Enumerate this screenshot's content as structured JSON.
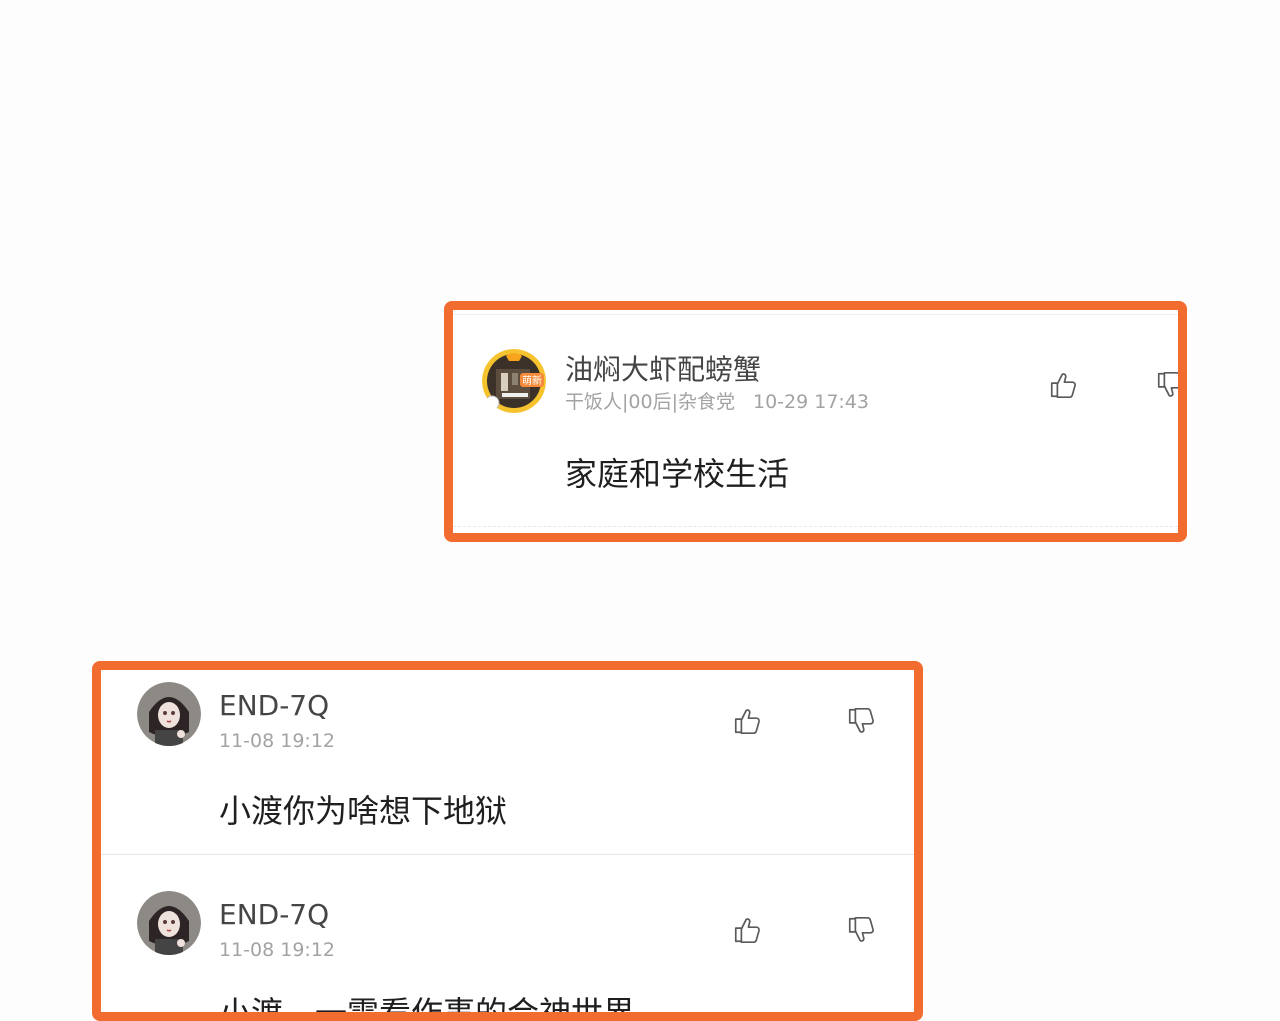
{
  "comments": [
    {
      "username": "油焖大虾配螃蟹",
      "tags": "干饭人|00后|杂食党",
      "time": "10-29 17:43",
      "text": "家庭和学校生活",
      "avatar_badge": "萌新",
      "avatar_icon": "duck-mascot-avatar"
    },
    {
      "username": "END-7Q",
      "time": "11-08 19:12",
      "text": "小渡你为啥想下地狱",
      "avatar_icon": "anime-girl-avatar"
    },
    {
      "username": "END-7Q",
      "time": "11-08 19:12",
      "text": "小渡，一需看作事的合神世界",
      "avatar_icon": "anime-girl-avatar"
    }
  ],
  "icons": {
    "like": "thumbs-up-icon",
    "dislike": "thumbs-down-icon"
  },
  "colors": {
    "highlight_border": "#f26b2f",
    "text_primary": "#1f1f1f",
    "text_secondary": "#a3a3a3"
  }
}
